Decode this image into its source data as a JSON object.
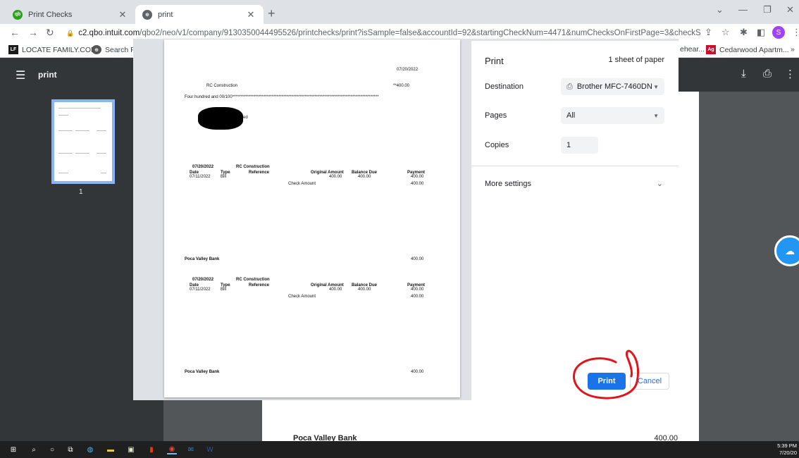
{
  "tabs": [
    {
      "title": "Print Checks",
      "favicon": "qb-icon",
      "color": "#2ca01c",
      "active": false
    },
    {
      "title": "print",
      "favicon": "globe-icon",
      "color": "#5f6368",
      "active": true
    }
  ],
  "address": {
    "host": "c2.qbo.intuit.com",
    "path": "/qbo2/neo/v1/company/9130350044495526/printchecks/print?isSample=false&accountId=92&startingCheckNum=4471&numChecksOnFirstPage=3&checkStockType..."
  },
  "bookmarks": [
    {
      "label": "LOCATE FAMILY.COM",
      "icon": "LF",
      "color": "#1b1b1b"
    },
    {
      "label": "Search Pe",
      "icon": "globe",
      "color": "#555"
    },
    {
      "label": "ehear...",
      "icon": "",
      "color": "#fff"
    },
    {
      "label": "Cedarwood Apartm...",
      "icon": "Ag",
      "color": "#c8102e"
    },
    {
      "label": "»",
      "icon": "",
      "color": "#fff"
    }
  ],
  "pdf": {
    "title": "print",
    "page_number": "1"
  },
  "preview": {
    "date": "07/20/2022",
    "payee": "RC Construction",
    "amount_stars": "**400.00",
    "amount_words": "Four hundred and 00/100*****************************************************************************************",
    "redacted_suffix": "ed",
    "stub1": {
      "date": "07/20/2022",
      "payee": "RC Construction",
      "headers": [
        "Date",
        "Type",
        "Reference",
        "Original Amount",
        "Balance Due",
        "Payment"
      ],
      "row": [
        "07/11/2022",
        "Bill",
        "",
        "400.00",
        "400.00",
        "400.00"
      ],
      "check_amount_label": "Check Amount",
      "check_amount": "400.00",
      "bank": "Poca Valley Bank",
      "bank_amount": "400.00"
    },
    "stub2": {
      "date": "07/20/2022",
      "payee": "RC Construction",
      "headers": [
        "Date",
        "Type",
        "Reference",
        "Original Amount",
        "Balance Due",
        "Payment"
      ],
      "row": [
        "07/11/2022",
        "Bill",
        "",
        "400.00",
        "400.00",
        "400.00"
      ],
      "check_amount_label": "Check Amount",
      "check_amount": "400.00",
      "bank": "Poca Valley Bank",
      "bank_amount": "400.00"
    }
  },
  "print_panel": {
    "title": "Print",
    "sheets": "1 sheet of paper",
    "destination_label": "Destination",
    "destination_value": "Brother MFC-7460DN",
    "pages_label": "Pages",
    "pages_value": "All",
    "copies_label": "Copies",
    "copies_value": "1",
    "more_settings": "More settings",
    "print_button": "Print",
    "cancel_button": "Cancel"
  },
  "background_page": {
    "bank": "Poca Valley Bank",
    "amount": "400.00"
  },
  "clock": {
    "time": "5:39 PM",
    "date": "7/20/20"
  },
  "accent": "#1a73e8",
  "annotation_color": "#e0151b"
}
